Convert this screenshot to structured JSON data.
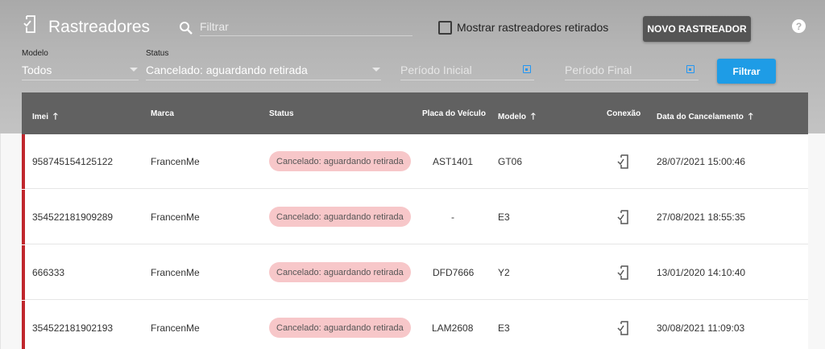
{
  "header": {
    "title": "Rastreadores",
    "title_icon": "tracker-phone-icon",
    "search": {
      "placeholder": "Filtrar",
      "value": ""
    },
    "show_retired_label": "Mostrar rastreadores retirados",
    "show_retired_checked": false,
    "new_button_label": "NOVO RASTREADOR",
    "help_icon": "help-icon",
    "help_glyph": "?"
  },
  "filters": {
    "modelo": {
      "label": "Modelo",
      "value": "Todos"
    },
    "status": {
      "label": "Status",
      "value": "Cancelado: aguardando retirada"
    },
    "periodo_inicial": {
      "placeholder": "Período Inicial"
    },
    "periodo_final": {
      "placeholder": "Período Final"
    },
    "filter_button_label": "Filtrar"
  },
  "table": {
    "columns": [
      {
        "label": "Imei",
        "sortable": true
      },
      {
        "label": "Marca",
        "sortable": false
      },
      {
        "label": "Status",
        "sortable": false
      },
      {
        "label": "Placa do Veículo",
        "sortable": false
      },
      {
        "label": "Modelo",
        "sortable": true
      },
      {
        "label": "Conexão",
        "sortable": false
      },
      {
        "label": "Data do Cancelamento",
        "sortable": true
      }
    ],
    "rows": [
      {
        "imei": "958745154125122",
        "marca": "FrancenMe",
        "status": "Cancelado: aguardando retirada",
        "placa": "AST1401",
        "modelo": "GT06",
        "data": "28/07/2021 15:00:46"
      },
      {
        "imei": "354522181909289",
        "marca": "FrancenMe",
        "status": "Cancelado: aguardando retirada",
        "placa": "-",
        "modelo": "E3",
        "data": "27/08/2021 18:55:35"
      },
      {
        "imei": "666333",
        "marca": "FrancenMe",
        "status": "Cancelado: aguardando retirada",
        "placa": "DFD7666",
        "modelo": "Y2",
        "data": "13/01/2020 14:10:40"
      },
      {
        "imei": "354522181902193",
        "marca": "FrancenMe",
        "status": "Cancelado: aguardando retirada",
        "placa": "LAM2608",
        "modelo": "E3",
        "data": "30/08/2021 11:09:03"
      }
    ],
    "sort_arrow": "🡑"
  },
  "colors": {
    "header_bg": "#b5b5b5",
    "table_header_bg": "#616161",
    "row_accent": "#c0272d",
    "status_badge_bg": "#f7c7c9",
    "primary_button": "#1e9ce6",
    "dark_button": "#555555"
  }
}
